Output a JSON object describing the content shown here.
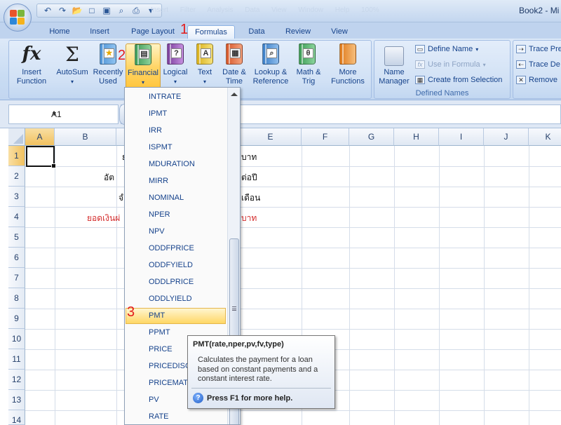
{
  "title": {
    "text": "Book2 - Mi",
    "ghost": "Insert Filter Analysis Data View Window Help 100%"
  },
  "qat": {
    "undo": "↶",
    "redo": "↷",
    "open": "📂",
    "new": "□",
    "save": "▣",
    "preview": "⌕",
    "print": "⎙",
    "more": "▾"
  },
  "tabs": [
    {
      "label": "Home"
    },
    {
      "label": "Insert"
    },
    {
      "label": "Page Layout"
    },
    {
      "label": "Formulas"
    },
    {
      "label": "Data"
    },
    {
      "label": "Review"
    },
    {
      "label": "View"
    }
  ],
  "steps": {
    "one": "1",
    "two": "2",
    "three": "3"
  },
  "ribbon": {
    "function_library": {
      "insert_function": "Insert Function",
      "autosum": "AutoSum",
      "recently_used": "Recently Used",
      "financial": "Financial",
      "logical": "Logical",
      "text": "Text",
      "date_time": "Date & Time",
      "lookup": "Lookup & Reference",
      "math": "Math & Trig",
      "more": "More Functions"
    },
    "defined_names": {
      "group_label": "Defined Names",
      "name_manager": "Name Manager",
      "define_name": "Define Name",
      "use_in_formula": "Use in Formula",
      "create_from_selection": "Create from Selection"
    },
    "auditing": {
      "trace_precedents": "Trace Pre",
      "trace_dependents": "Trace De",
      "remove": "Remove"
    }
  },
  "formula_bar": {
    "name_box": "A1",
    "value": ""
  },
  "grid": {
    "columns": [
      "A",
      "B",
      "C",
      "D",
      "E",
      "F",
      "G",
      "H",
      "I",
      "J",
      "K"
    ],
    "rows": [
      "1",
      "2",
      "3",
      "4",
      "5",
      "6",
      "7",
      "8",
      "9",
      "10",
      "11",
      "12",
      "13",
      "14"
    ],
    "cells": {
      "b1": "ย",
      "e1": "บาท",
      "b2": "อัต",
      "e2": "ต่อปี",
      "b3": "จำ",
      "e3": "เดือน",
      "b4": "ยอดเงินผ่",
      "e4": "บาท"
    }
  },
  "dropdown": {
    "items": [
      "INTRATE",
      "IPMT",
      "IRR",
      "ISPMT",
      "MDURATION",
      "MIRR",
      "NOMINAL",
      "NPER",
      "NPV",
      "ODDFPRICE",
      "ODDFYIELD",
      "ODDLPRICE",
      "ODDLYIELD",
      "PMT",
      "PPMT",
      "PRICE",
      "PRICEDISC",
      "PRICEMAT",
      "PV",
      "RATE"
    ],
    "highlighted": "PMT"
  },
  "tooltip": {
    "title": "PMT(rate,nper,pv,fv,type)",
    "description": "Calculates the payment for a loan based on constant payments and a constant interest rate.",
    "help": "Press F1 for more help."
  },
  "colors": {
    "accent": "#15428b",
    "highlight": "#ffd865",
    "step": "#e31b1b",
    "red_text": "#d42a2a"
  }
}
